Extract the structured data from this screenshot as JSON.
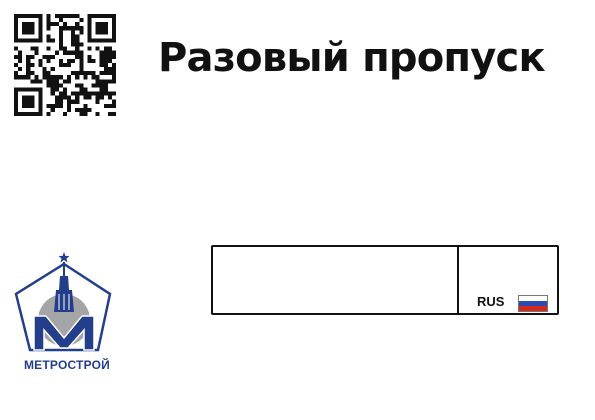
{
  "document": {
    "title": "Разовый пропуск"
  },
  "plate": {
    "number": "",
    "region_code": "",
    "country": "RUS"
  },
  "logo": {
    "text": "МЕТРОСТРОЙ"
  },
  "colors": {
    "text": "#111111",
    "logo_blue": "#233f8c",
    "logo_gray": "#a5a5a8",
    "flag_white": "#ffffff",
    "flag_blue": "#2a4bb0",
    "flag_red": "#d52b1e"
  },
  "icons": [
    "qr-code-icon",
    "russian-flag-icon",
    "metrostroy-logo"
  ]
}
